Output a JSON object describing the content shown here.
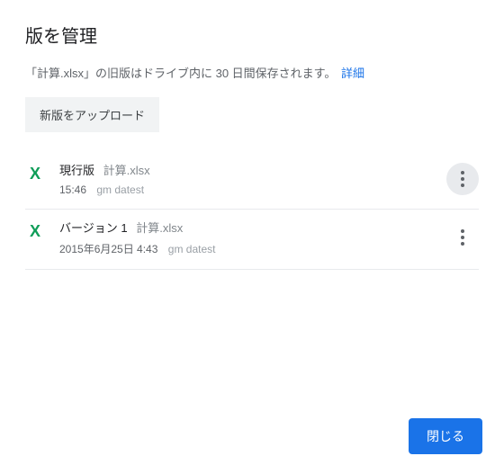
{
  "title": "版を管理",
  "info_text": "「計算.xlsx」の旧版はドライブ内に 30 日間保存されます。",
  "info_link": "詳細",
  "upload_button": "新版をアップロード",
  "file_icon_glyph": "X",
  "versions": [
    {
      "label": "現行版",
      "filename": "計算.xlsx",
      "timestamp": "15:46",
      "author": "gm datest",
      "more_filled": true
    },
    {
      "label": "バージョン 1",
      "filename": "計算.xlsx",
      "timestamp": "2015年6月25日 4:43",
      "author": "gm datest",
      "more_filled": false
    }
  ],
  "close_button": "閉じる"
}
